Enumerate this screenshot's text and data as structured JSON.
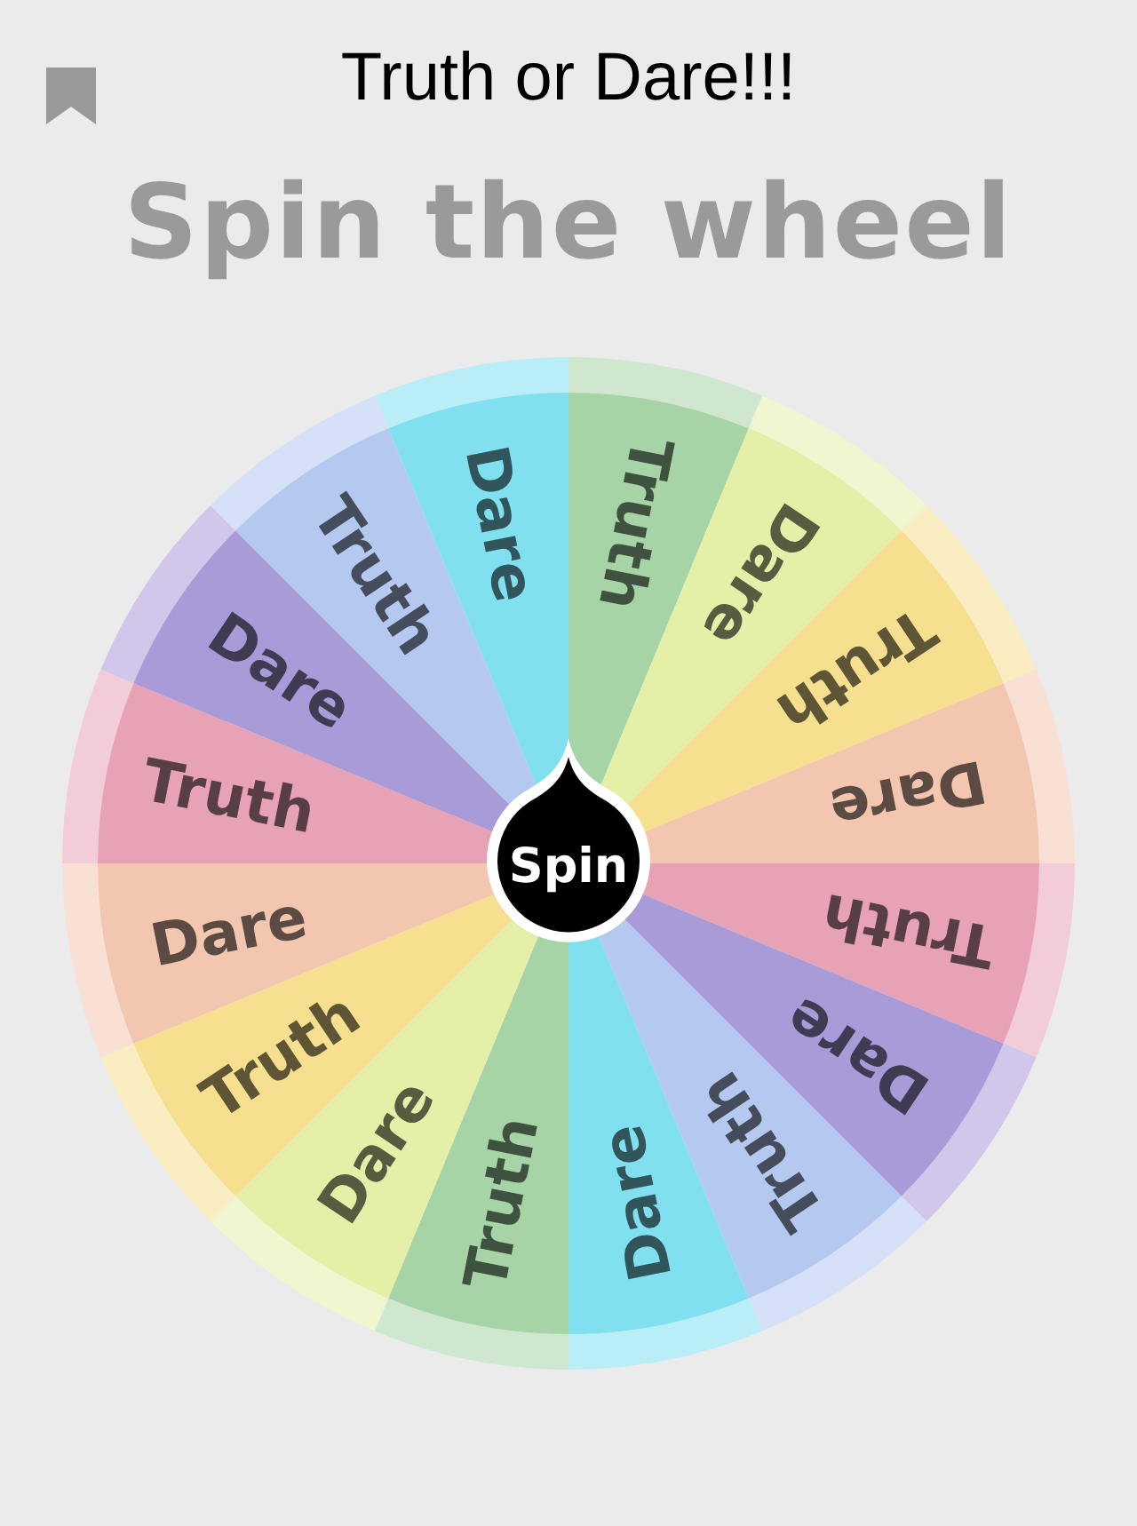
{
  "title": "Truth or Dare!!!",
  "heading": "Spin the wheel",
  "segments": [
    {
      "label": "Truth",
      "color": "#a6d4a6"
    },
    {
      "label": "Dare",
      "color": "#e4efa8"
    },
    {
      "label": "Truth",
      "color": "#f6df8e"
    },
    {
      "label": "Dare",
      "color": "#f3c6b0"
    },
    {
      "label": "Truth",
      "color": "#e8a2b6"
    },
    {
      "label": "Dare",
      "color": "#a99ad8"
    },
    {
      "label": "Truth",
      "color": "#b5c9f0"
    },
    {
      "label": "Dare",
      "color": "#80e0f0"
    },
    {
      "label": "Truth",
      "color": "#a6d4a6"
    },
    {
      "label": "Dare",
      "color": "#e4efa8"
    },
    {
      "label": "Truth",
      "color": "#f6df8e"
    },
    {
      "label": "Dare",
      "color": "#f3c6b0"
    },
    {
      "label": "Truth",
      "color": "#e8a2b6"
    },
    {
      "label": "Dare",
      "color": "#a99ad8"
    },
    {
      "label": "Truth",
      "color": "#b5c9f0"
    },
    {
      "label": "Dare",
      "color": "#80e0f0"
    }
  ],
  "spin_button": "Spin"
}
